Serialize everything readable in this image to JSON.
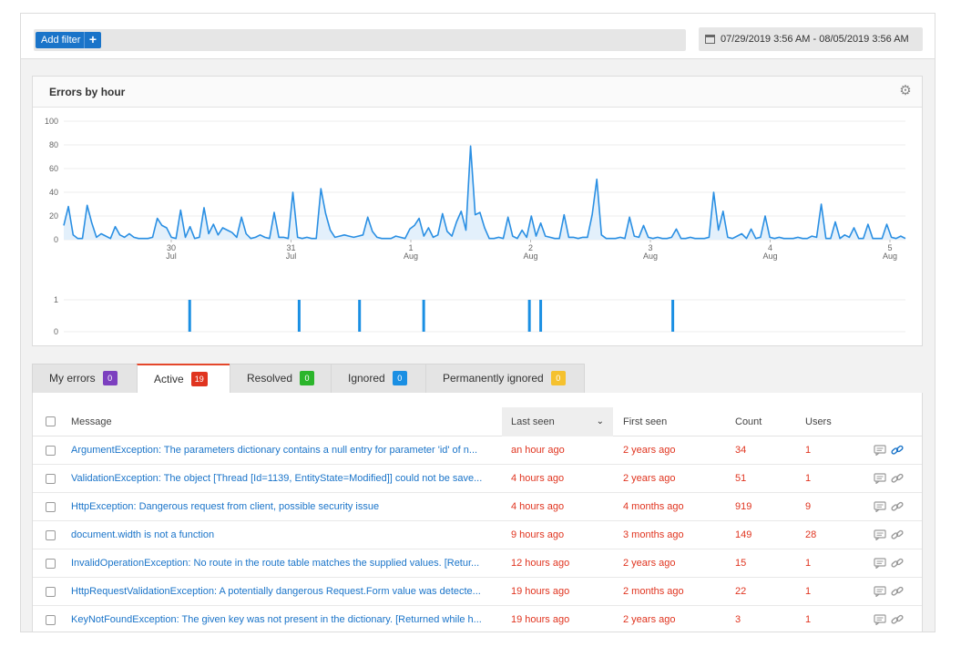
{
  "toolbar": {
    "add_filter_label": "Add filter",
    "add_filter_plus": "+",
    "date_range": "07/29/2019 3:56 AM - 08/05/2019 3:56 AM"
  },
  "chart": {
    "title": "Errors by hour"
  },
  "chart_data": [
    {
      "type": "area",
      "y_ticks": [
        0,
        20,
        40,
        60,
        80,
        100
      ],
      "ylim": [
        0,
        100
      ],
      "x_tick_labels": [
        {
          "day": "30",
          "month": "Jul"
        },
        {
          "day": "31",
          "month": "Jul"
        },
        {
          "day": "1",
          "month": "Aug"
        },
        {
          "day": "2",
          "month": "Aug"
        },
        {
          "day": "3",
          "month": "Aug"
        },
        {
          "day": "4",
          "month": "Aug"
        },
        {
          "day": "5",
          "month": "Aug"
        }
      ],
      "values": [
        12,
        28,
        4,
        1,
        1,
        29,
        14,
        2,
        5,
        3,
        1,
        11,
        4,
        2,
        5,
        2,
        1,
        1,
        1,
        2,
        18,
        12,
        10,
        2,
        1,
        25,
        2,
        11,
        1,
        2,
        27,
        5,
        13,
        4,
        10,
        8,
        6,
        2,
        19,
        5,
        1,
        2,
        4,
        2,
        1,
        23,
        2,
        2,
        1,
        40,
        2,
        1,
        2,
        1,
        1,
        43,
        22,
        8,
        2,
        3,
        4,
        3,
        2,
        3,
        4,
        19,
        7,
        2,
        1,
        1,
        1,
        3,
        2,
        1,
        9,
        12,
        18,
        3,
        10,
        2,
        4,
        22,
        7,
        3,
        15,
        24,
        8,
        79,
        21,
        23,
        10,
        1,
        1,
        2,
        1,
        19,
        3,
        1,
        8,
        2,
        20,
        3,
        14,
        3,
        2,
        1,
        1,
        21,
        2,
        2,
        1,
        2,
        2,
        21,
        51,
        4,
        1,
        1,
        1,
        2,
        1,
        19,
        3,
        2,
        12,
        2,
        1,
        2,
        1,
        1,
        2,
        9,
        1,
        1,
        2,
        1,
        1,
        1,
        2,
        40,
        8,
        24,
        2,
        1,
        3,
        5,
        1,
        9,
        1,
        2,
        20,
        2,
        1,
        2,
        1,
        1,
        1,
        2,
        1,
        1,
        3,
        2,
        30,
        1,
        1,
        15,
        1,
        4,
        2,
        10,
        1,
        1,
        13,
        1,
        1,
        1,
        13,
        2,
        1,
        3,
        1
      ]
    },
    {
      "type": "bar",
      "y_ticks": [
        0,
        1
      ],
      "ylim": [
        0,
        1
      ],
      "values": [
        0,
        0,
        0,
        0,
        0,
        0,
        0,
        0,
        0,
        0,
        0,
        0,
        0,
        0,
        0,
        0,
        0,
        0,
        0,
        0,
        0,
        0,
        0,
        0,
        0,
        0,
        0,
        0,
        0,
        0,
        0,
        0,
        0,
        1,
        0,
        0,
        0,
        0,
        0,
        0,
        0,
        0,
        0,
        0,
        0,
        0,
        0,
        0,
        0,
        0,
        0,
        0,
        0,
        0,
        0,
        0,
        0,
        0,
        0,
        0,
        0,
        0,
        1,
        0,
        0,
        0,
        0,
        0,
        0,
        0,
        0,
        0,
        0,
        0,
        0,
        0,
        0,
        0,
        1,
        0,
        0,
        0,
        0,
        0,
        0,
        0,
        0,
        0,
        0,
        0,
        0,
        0,
        0,
        0,
        0,
        1,
        0,
        0,
        0,
        0,
        0,
        0,
        0,
        0,
        0,
        0,
        0,
        0,
        0,
        0,
        0,
        0,
        0,
        0,
        0,
        0,
        0,
        0,
        0,
        0,
        0,
        0,
        0,
        1,
        0,
        0,
        1,
        0,
        0,
        0,
        0,
        0,
        0,
        0,
        0,
        0,
        0,
        0,
        0,
        0,
        0,
        0,
        0,
        0,
        0,
        0,
        0,
        0,
        0,
        0,
        0,
        0,
        0,
        0,
        0,
        0,
        0,
        0,
        0,
        0,
        0,
        1,
        0,
        0,
        0,
        0,
        0,
        0,
        0,
        0,
        0,
        0,
        0,
        0,
        0,
        0,
        0,
        0,
        0,
        0,
        0,
        0,
        0,
        0,
        0,
        0,
        0,
        0,
        0,
        0,
        0,
        0,
        0,
        0,
        0,
        0,
        0,
        0,
        0,
        0,
        0,
        0,
        0,
        0,
        0,
        0,
        0,
        0,
        0,
        0,
        0,
        0,
        0,
        0,
        0,
        0,
        0,
        0,
        0,
        0,
        0,
        0,
        0
      ]
    }
  ],
  "tabs": [
    {
      "label": "My errors",
      "count": "0",
      "color": "#7c3fbf"
    },
    {
      "label": "Active",
      "count": "19",
      "color": "#e0341f"
    },
    {
      "label": "Resolved",
      "count": "0",
      "color": "#2bb52b"
    },
    {
      "label": "Ignored",
      "count": "0",
      "color": "#1a8fe3"
    },
    {
      "label": "Permanently ignored",
      "count": "0",
      "color": "#f5c12e"
    }
  ],
  "table": {
    "headers": {
      "message": "Message",
      "last_seen": "Last seen",
      "first_seen": "First seen",
      "count": "Count",
      "users": "Users"
    },
    "rows": [
      {
        "message": "ArgumentException: The parameters dictionary contains a null entry for parameter 'id' of n...",
        "last_seen": "an hour ago",
        "first_seen": "2 years ago",
        "count": "34",
        "users": "1",
        "linked": true
      },
      {
        "message": "ValidationException: The object [Thread [Id=1139, EntityState=Modified]] could not be save...",
        "last_seen": "4 hours ago",
        "first_seen": "2 years ago",
        "count": "51",
        "users": "1",
        "linked": false
      },
      {
        "message": "HttpException: Dangerous request from client, possible security issue",
        "last_seen": "4 hours ago",
        "first_seen": "4 months ago",
        "count": "919",
        "users": "9",
        "linked": false
      },
      {
        "message": "document.width is not a function",
        "last_seen": "9 hours ago",
        "first_seen": "3 months ago",
        "count": "149",
        "users": "28",
        "linked": false
      },
      {
        "message": "InvalidOperationException: No route in the route table matches the supplied values. [Retur...",
        "last_seen": "12 hours ago",
        "first_seen": "2 years ago",
        "count": "15",
        "users": "1",
        "linked": false
      },
      {
        "message": "HttpRequestValidationException: A potentially dangerous Request.Form value was detecte...",
        "last_seen": "19 hours ago",
        "first_seen": "2 months ago",
        "count": "22",
        "users": "1",
        "linked": false
      },
      {
        "message": "KeyNotFoundException: The given key was not present in the dictionary. [Returned while h...",
        "last_seen": "19 hours ago",
        "first_seen": "2 years ago",
        "count": "3",
        "users": "1",
        "linked": false
      }
    ]
  },
  "colors": {
    "accent": "#1a74c9",
    "line": "#2a8fe3",
    "fill": "#e3f0fb",
    "error_text": "#e0341f"
  }
}
